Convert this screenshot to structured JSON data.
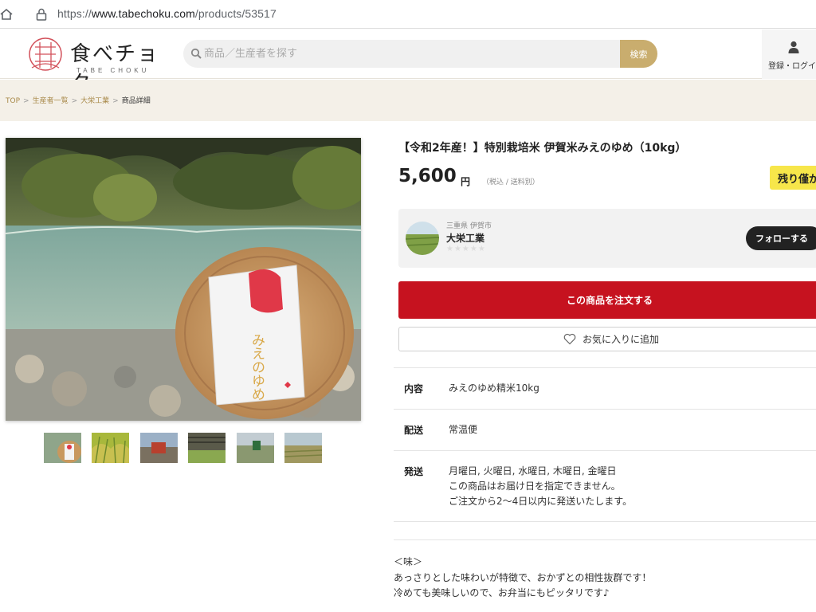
{
  "browser": {
    "url_prefix": "https://",
    "url_main": "www.tabechoku.com",
    "url_path": "/products/53517"
  },
  "header": {
    "logo_text": "食べチョク",
    "logo_sub": "TABE CHOKU",
    "search_placeholder": "商品／生産者を探す",
    "search_button": "検索",
    "login_label": "登録・ログイン"
  },
  "breadcrumb": {
    "items": [
      "TOP",
      "生産者一覧",
      "大栄工業"
    ],
    "current": "商品詳細"
  },
  "product": {
    "title": "【令和2年産！】特別栽培米 伊賀米みえのゆめ（10kg）",
    "price": "5,600",
    "price_unit": "円",
    "tax_note": "（税込 / 送料別）",
    "stock_badge": "残り僅か",
    "bag_text": "みえのゆめ"
  },
  "producer": {
    "region": "三重県 伊賀市",
    "name": "大栄工業",
    "rating": "★★★★★",
    "follow_button": "フォローする"
  },
  "actions": {
    "order_button": "この商品を注文する",
    "favorite_button": "お気に入りに追加"
  },
  "details": {
    "contents_label": "内容",
    "contents_value": "みえのゆめ精米10kg",
    "shipping_label": "配送",
    "shipping_value": "常温便",
    "dispatch_label": "発送",
    "dispatch_lines": [
      "月曜日, 火曜日, 水曜日, 木曜日, 金曜日",
      "この商品はお届け日を指定できません。",
      "ご注文から2〜4日以内に発送いたします。"
    ]
  },
  "description": {
    "lines": [
      "＜味＞",
      "あっさりとした味わいが特徴で、おかずとの相性抜群です！",
      "冷めても美味しいので、お弁当にもピッタリです♪"
    ]
  },
  "colors": {
    "accent_gold": "#c9ad6e",
    "order_red": "#c6121f",
    "badge_yellow": "#f7e64a",
    "breadcrumb_bg": "#f4f0e8"
  }
}
